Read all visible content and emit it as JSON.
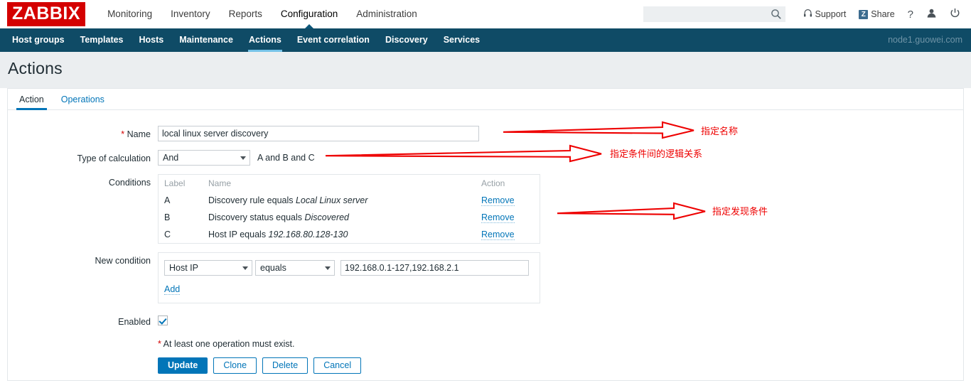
{
  "brand": {
    "logo": "ZABBIX"
  },
  "mainnav": [
    {
      "label": "Monitoring",
      "selected": false
    },
    {
      "label": "Inventory",
      "selected": false
    },
    {
      "label": "Reports",
      "selected": false
    },
    {
      "label": "Configuration",
      "selected": true
    },
    {
      "label": "Administration",
      "selected": false
    }
  ],
  "topright": {
    "search_value": "",
    "search_placeholder": "",
    "support_label": "Support",
    "share_label": "Share",
    "share_badge": "Z",
    "help_label": "?"
  },
  "subnav": {
    "items": [
      {
        "label": "Host groups",
        "selected": false
      },
      {
        "label": "Templates",
        "selected": false
      },
      {
        "label": "Hosts",
        "selected": false
      },
      {
        "label": "Maintenance",
        "selected": false
      },
      {
        "label": "Actions",
        "selected": true
      },
      {
        "label": "Event correlation",
        "selected": false
      },
      {
        "label": "Discovery",
        "selected": false
      },
      {
        "label": "Services",
        "selected": false
      }
    ],
    "node": "node1.guowei.com"
  },
  "page": {
    "title": "Actions"
  },
  "tabs": [
    {
      "label": "Action",
      "active": true
    },
    {
      "label": "Operations",
      "active": false
    }
  ],
  "form": {
    "name": {
      "label": "Name",
      "required_mark": "*",
      "value": "local linux server discovery",
      "placeholder": ""
    },
    "type_of_calculation": {
      "label": "Type of calculation",
      "value": "And",
      "formula": "A and B and C"
    },
    "conditions": {
      "label": "Conditions",
      "headers": {
        "label": "Label",
        "name": "Name",
        "action": "Action"
      },
      "rows": [
        {
          "label": "A",
          "name_prefix": "Discovery rule equals ",
          "name_value": "Local Linux server",
          "action": "Remove"
        },
        {
          "label": "B",
          "name_prefix": "Discovery status equals ",
          "name_value": "Discovered",
          "action": "Remove"
        },
        {
          "label": "C",
          "name_prefix": "Host IP equals ",
          "name_value": "192.168.80.128-130",
          "action": "Remove"
        }
      ]
    },
    "new_condition": {
      "label": "New condition",
      "field": "Host IP",
      "operator": "equals",
      "value": "192.168.0.1-127,192.168.2.1",
      "add_label": "Add"
    },
    "enabled": {
      "label": "Enabled",
      "checked": true
    },
    "footnote": {
      "mark": "*",
      "text": "At least one operation must exist."
    },
    "buttons": [
      {
        "label": "Update",
        "primary": true
      },
      {
        "label": "Clone",
        "primary": false
      },
      {
        "label": "Delete",
        "primary": false
      },
      {
        "label": "Cancel",
        "primary": false
      }
    ]
  },
  "annotations": [
    {
      "text": "指定名称"
    },
    {
      "text": "指定条件间的逻辑关系"
    },
    {
      "text": "指定发现条件"
    }
  ],
  "colors": {
    "brand_red": "#d40000",
    "subnav_bg": "#0f4b66",
    "accent_blue": "#0275b8",
    "annotation_red": "#ee0000"
  }
}
